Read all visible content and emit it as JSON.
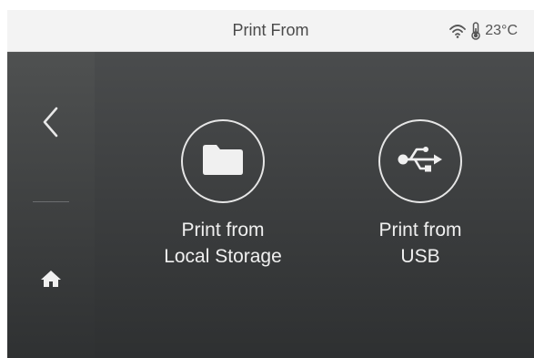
{
  "header": {
    "title": "Print From",
    "temperature": "23°C",
    "wifi_icon": "wifi-icon",
    "thermometer_icon": "thermometer-icon"
  },
  "sidebar": {
    "back_icon": "chevron-left-icon",
    "home_icon": "home-icon"
  },
  "options": [
    {
      "icon": "folder-icon",
      "label_line1": "Print from",
      "label_line2": "Local Storage"
    },
    {
      "icon": "usb-icon",
      "label_line1": "Print from",
      "label_line2": "USB"
    }
  ],
  "colors": {
    "header_bg": "#f3f3f3",
    "sidebar_bg": "#4f5151",
    "main_bg": "#3d3f40",
    "icon_white": "#f0f0f0"
  }
}
